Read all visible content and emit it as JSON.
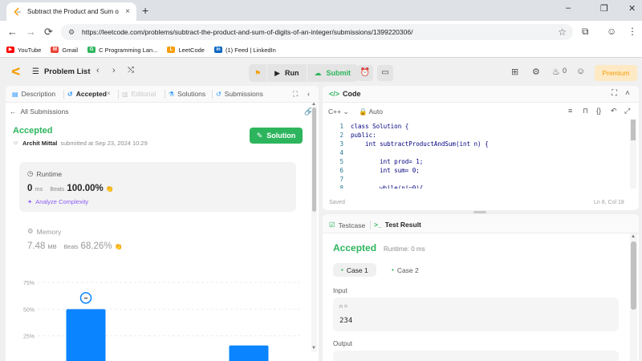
{
  "browser": {
    "tab_title": "Subtract the Product and Sum o",
    "tab_close": "×",
    "new_tab": "+",
    "win_min": "–",
    "win_max": "❐",
    "win_close": "✕",
    "back": "←",
    "forward": "→",
    "reload": "⟳",
    "url": "https://leetcode.com/problems/subtract-the-product-and-sum-of-digits-of-an-integer/submissions/1399220306/",
    "bookmarks": [
      {
        "label": "YouTube",
        "color": "#ff0000"
      },
      {
        "label": "Gmail",
        "color": "#ea4335"
      },
      {
        "label": "C Programming Lan...",
        "color": "#2db55d"
      },
      {
        "label": "LeetCode",
        "color": "#f59e0b"
      },
      {
        "label": "(1) Feed | LinkedIn",
        "color": "#0a66c2"
      }
    ]
  },
  "nav": {
    "problem_list": "Problem List",
    "run": "Run",
    "submit": "Submit",
    "streak": "0",
    "premium": "Premium"
  },
  "left": {
    "tabs": {
      "description": "Description",
      "accepted": "Accepted",
      "editorial": "Editorial",
      "solutions": "Solutions",
      "submissions": "Submissions"
    },
    "all_submissions": "All Submissions",
    "status": "Accepted",
    "author": "Archit Mittal",
    "submitted": "submitted at Sep 23, 2024 10:29",
    "solution_button": "Solution",
    "runtime": {
      "label": "Runtime",
      "value": "0",
      "unit": "ms",
      "beats_label": "Beats",
      "beats": "100.00%",
      "analyze": "Analyze Complexity"
    },
    "memory": {
      "label": "Memory",
      "value": "7.48",
      "unit": "MB",
      "beats_label": "Beats",
      "beats": "68.26%"
    }
  },
  "chart_data": {
    "type": "bar",
    "categories": [
      "",
      "",
      ""
    ],
    "values": [
      50,
      1,
      16
    ],
    "yticks": [
      "75%",
      "50%",
      "25%",
      "0%"
    ],
    "ylim": [
      0,
      75
    ],
    "title": "",
    "xlabel": "",
    "ylabel": "",
    "bar_color": "#0a84ff"
  },
  "code": {
    "title": "Code",
    "language": "C++",
    "mode": "Auto",
    "lines": [
      {
        "n": "1",
        "t": "class Solution {"
      },
      {
        "n": "2",
        "t": "public:"
      },
      {
        "n": "3",
        "t": "    int subtractProductAndSum(int n) {"
      },
      {
        "n": "4",
        "t": ""
      },
      {
        "n": "5",
        "t": "        int prod= 1;"
      },
      {
        "n": "6",
        "t": "        int sum= 0;"
      },
      {
        "n": "7",
        "t": ""
      },
      {
        "n": "8",
        "t": "        while(n!=0){"
      }
    ],
    "saved": "Saved",
    "cursor": "Ln 8, Col 18"
  },
  "result": {
    "tabs": {
      "testcase": "Testcase",
      "test_result": "Test Result"
    },
    "status": "Accepted",
    "runtime": "Runtime: 0 ms",
    "case1": "Case 1",
    "case2": "Case 2",
    "input_label": "Input",
    "var_name": "n =",
    "var_value": "234",
    "output_label": "Output"
  }
}
